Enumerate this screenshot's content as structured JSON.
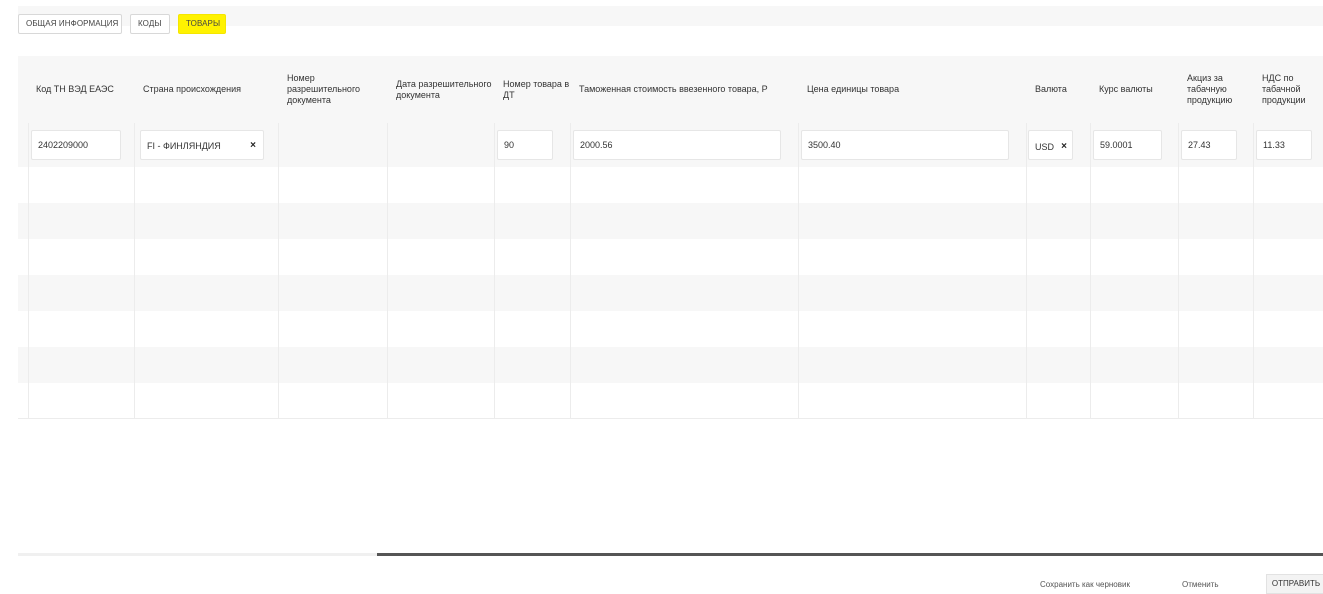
{
  "tabs": {
    "general": "ОБЩАЯ ИНФОРМАЦИЯ",
    "codes": "КОДЫ",
    "goods": "ТОВАРЫ"
  },
  "columns": [
    "Код ТН ВЭД ЕАЭС",
    "Страна происхождения",
    "Номер разрешительного документа",
    "Дата разрешительного документа",
    "Номер товара в ДТ",
    "Таможенная стоимость ввезенного товара, Р",
    "Цена единицы товара",
    "Валюта",
    "Курс валюты",
    "Акциз за табачную продукцию",
    "НДС по табачной продукции"
  ],
  "row": {
    "tnved_code": "2402209000",
    "country": "FI - ФИНЛЯНДИЯ",
    "goods_number": "90",
    "customs_value": "2000.56",
    "unit_price": "3500.40",
    "currency": "USD",
    "exchange_rate": "59.0001",
    "excise": "27.43",
    "vat": "11.33"
  },
  "icons": {
    "clear": "×"
  },
  "footer": {
    "save_draft": "Сохранить как черновик",
    "cancel": "Отменить",
    "send": "ОТПРАВИТЬ"
  }
}
